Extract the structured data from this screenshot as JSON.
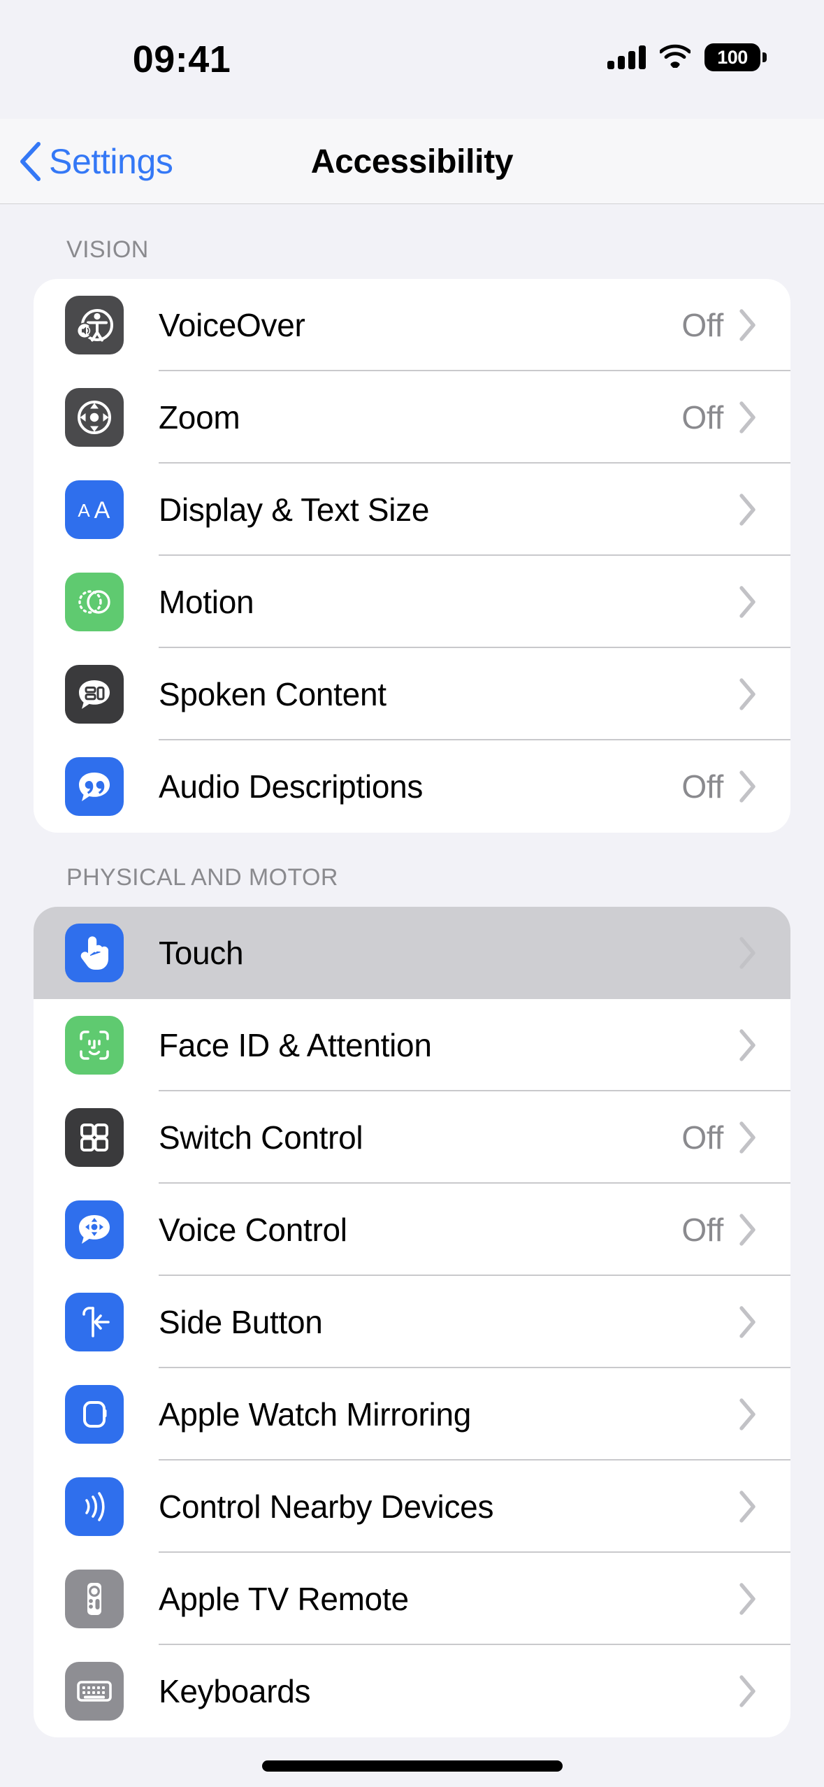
{
  "status_bar": {
    "time": "09:41",
    "cellular_icon": "cellular-signal-icon",
    "wifi_icon": "wifi-icon",
    "battery_icon": "battery-icon",
    "battery_percent": "100"
  },
  "nav_bar": {
    "back_icon": "chevron-left-icon",
    "back_label": "Settings",
    "title": "Accessibility"
  },
  "sections": [
    {
      "header": "VISION",
      "rows": [
        {
          "label": "VoiceOver",
          "value": "Off",
          "icon": "voiceover-icon",
          "icon_color": "#4A4A4C",
          "chevron": "chevron-right-icon"
        },
        {
          "label": "Zoom",
          "value": "Off",
          "icon": "zoom-icon",
          "icon_color": "#4A4A4C",
          "chevron": "chevron-right-icon"
        },
        {
          "label": "Display & Text Size",
          "value": "",
          "icon": "display-text-size-icon",
          "icon_color": "#2F6FED",
          "chevron": "chevron-right-icon"
        },
        {
          "label": "Motion",
          "value": "",
          "icon": "motion-icon",
          "icon_color": "#5FCA70",
          "chevron": "chevron-right-icon"
        },
        {
          "label": "Spoken Content",
          "value": "",
          "icon": "spoken-content-icon",
          "icon_color": "#3A3A3C",
          "chevron": "chevron-right-icon"
        },
        {
          "label": "Audio Descriptions",
          "value": "Off",
          "icon": "audio-descriptions-icon",
          "icon_color": "#2F6FED",
          "chevron": "chevron-right-icon"
        }
      ]
    },
    {
      "header": "PHYSICAL AND MOTOR",
      "rows": [
        {
          "label": "Touch",
          "value": "",
          "icon": "touch-icon",
          "icon_color": "#2F6FED",
          "chevron": "chevron-right-icon",
          "selected": true
        },
        {
          "label": "Face ID & Attention",
          "value": "",
          "icon": "face-id-icon",
          "icon_color": "#5FCA70",
          "chevron": "chevron-right-icon"
        },
        {
          "label": "Switch Control",
          "value": "Off",
          "icon": "switch-control-icon",
          "icon_color": "#3A3A3C",
          "chevron": "chevron-right-icon"
        },
        {
          "label": "Voice Control",
          "value": "Off",
          "icon": "voice-control-icon",
          "icon_color": "#2F6FED",
          "chevron": "chevron-right-icon"
        },
        {
          "label": "Side Button",
          "value": "",
          "icon": "side-button-icon",
          "icon_color": "#2F6FED",
          "chevron": "chevron-right-icon"
        },
        {
          "label": "Apple Watch Mirroring",
          "value": "",
          "icon": "apple-watch-mirroring-icon",
          "icon_color": "#2F6FED",
          "chevron": "chevron-right-icon"
        },
        {
          "label": "Control Nearby Devices",
          "value": "",
          "icon": "control-nearby-devices-icon",
          "icon_color": "#2F6FED",
          "chevron": "chevron-right-icon"
        },
        {
          "label": "Apple TV Remote",
          "value": "",
          "icon": "apple-tv-remote-icon",
          "icon_color": "#8E8E93",
          "chevron": "chevron-right-icon"
        },
        {
          "label": "Keyboards",
          "value": "",
          "icon": "keyboards-icon",
          "icon_color": "#8E8E93",
          "chevron": "chevron-right-icon"
        }
      ]
    }
  ],
  "home_indicator": "home-indicator",
  "colors": {
    "page_background": "#F2F2F7",
    "card_background": "#FFFFFF",
    "accent_blue": "#3478F6",
    "secondary_text": "#8A8A8E",
    "separator": "#C9C9CC",
    "selected_row": "#CECED2"
  }
}
